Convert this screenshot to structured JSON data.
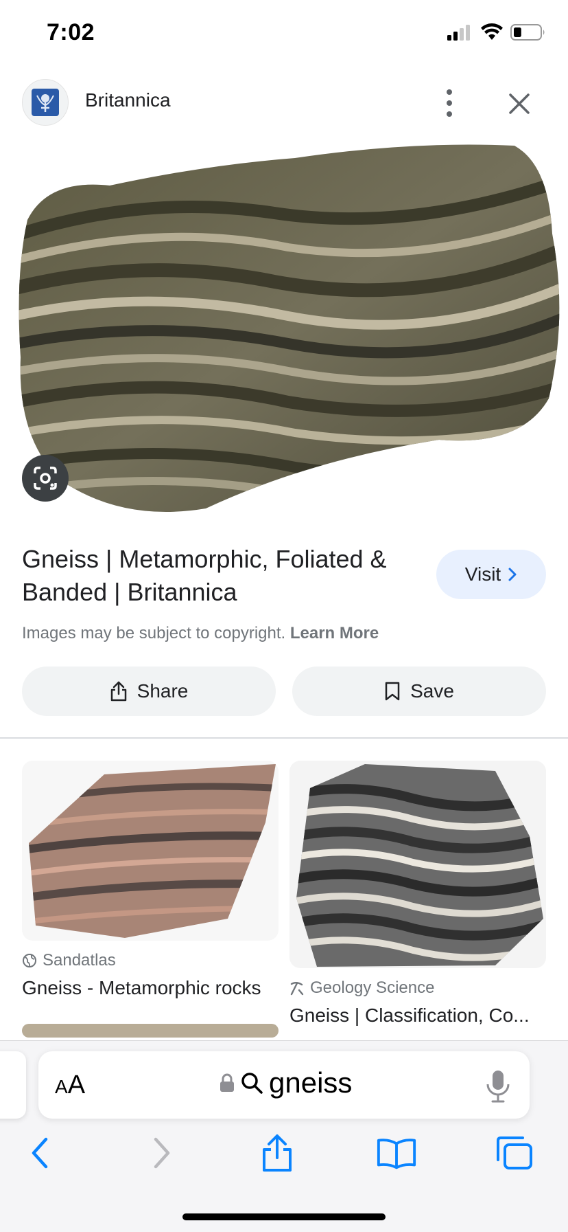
{
  "status_bar": {
    "time": "7:02",
    "battery_level": 0.3
  },
  "header": {
    "source_name": "Britannica",
    "icons": {
      "logo": "britannica-thistle-icon",
      "more": "more-vert-icon",
      "close": "close-icon"
    }
  },
  "result": {
    "title": "Gneiss | Metamorphic, Foliated & Banded | Britannica",
    "visit_label": "Visit",
    "copyright_text": "Images may be subject to copyright.",
    "learn_more_label": "Learn More",
    "share_label": "Share",
    "save_label": "Save"
  },
  "related": [
    {
      "source": "Sandatlas",
      "title": "Gneiss - Metamorphic rocks",
      "source_icon": "globe-icon"
    },
    {
      "source": "Geology Science",
      "title": "Gneiss | Classification, Co...",
      "source_icon": "pickaxe-icon"
    }
  ],
  "browser": {
    "aa_small": "A",
    "aa_large": "A",
    "query": "gneiss"
  },
  "colors": {
    "accent": "#1a73e8",
    "safari_blue": "#0a84ff",
    "visit_bg": "#e8f0fe",
    "pill_bg": "#f1f3f4"
  }
}
